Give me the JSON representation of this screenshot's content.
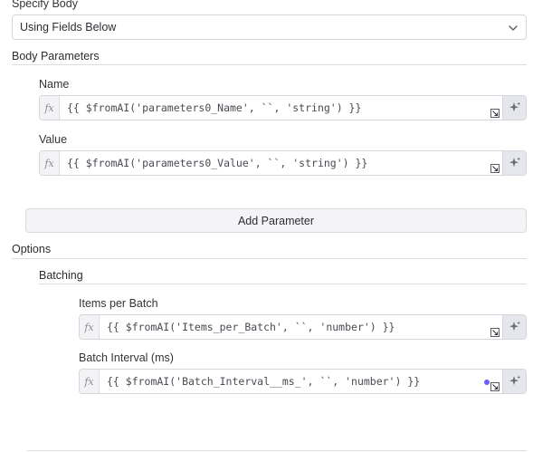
{
  "specify_body": {
    "label": "Specify Body",
    "selected": "Using Fields Below",
    "chevron_icon": "chevron-down-icon"
  },
  "body_parameters": {
    "title": "Body Parameters",
    "fields": [
      {
        "label": "Name",
        "fx": "fx",
        "expression": "{{ $fromAI('parameters0_Name', ``, 'string') }}"
      },
      {
        "label": "Value",
        "fx": "fx",
        "expression": "{{ $fromAI('parameters0_Value', ``, 'string') }}"
      }
    ],
    "add_button": "Add Parameter"
  },
  "options": {
    "title": "Options",
    "batching": {
      "title": "Batching",
      "fields": [
        {
          "label": "Items per Batch",
          "fx": "fx",
          "expression": "{{ $fromAI('Items_per_Batch', ``, 'number') }}"
        },
        {
          "label": "Batch Interval (ms)",
          "fx": "fx",
          "expression": "{{ $fromAI('Batch_Interval__ms_', ``, 'number') }}"
        }
      ]
    }
  },
  "colors": {
    "accent_dot": "#6a5cff",
    "ai_button_bg": "#e6e7ec"
  }
}
